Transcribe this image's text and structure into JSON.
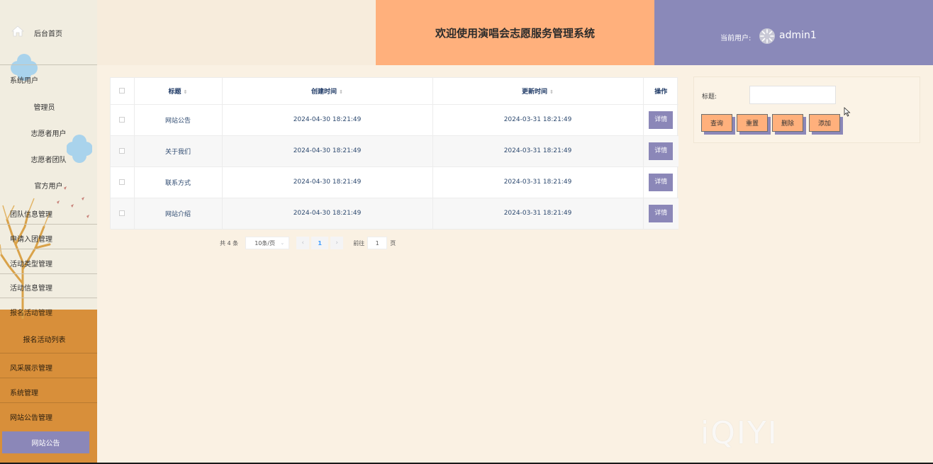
{
  "sidebar": {
    "home_label": "后台首页",
    "items": [
      {
        "label": "系统用户"
      },
      {
        "label": "管理员"
      },
      {
        "label": "志愿者用户"
      },
      {
        "label": "志愿者团队"
      },
      {
        "label": "官方用户"
      },
      {
        "label": "团队信息管理"
      },
      {
        "label": "申请入团管理"
      },
      {
        "label": "活动类型管理"
      },
      {
        "label": "活动信息管理"
      },
      {
        "label": "报名活动管理"
      },
      {
        "label": "报名活动列表"
      },
      {
        "label": "风采展示管理"
      },
      {
        "label": "系统管理"
      },
      {
        "label": "网站公告管理"
      },
      {
        "label": "网站公告"
      }
    ]
  },
  "header": {
    "title": "欢迎使用演唱会志愿服务管理系统",
    "current_user_label": "当前用户:",
    "username": "admin1"
  },
  "table": {
    "columns": [
      "标题",
      "创建时间",
      "更新时间",
      "操作"
    ],
    "rows": [
      {
        "title": "网站公告",
        "created": "2024-04-30 18:21:49",
        "updated": "2024-03-31 18:21:49",
        "action": "详情"
      },
      {
        "title": "关于我们",
        "created": "2024-04-30 18:21:49",
        "updated": "2024-03-31 18:21:49",
        "action": "详情"
      },
      {
        "title": "联系方式",
        "created": "2024-04-30 18:21:49",
        "updated": "2024-03-31 18:21:49",
        "action": "详情"
      },
      {
        "title": "网站介绍",
        "created": "2024-04-30 18:21:49",
        "updated": "2024-03-31 18:21:49",
        "action": "详情"
      }
    ]
  },
  "pager": {
    "total": "共 4 条",
    "page_size": "10条/页",
    "current_page": "1",
    "goto_label": "前往",
    "goto_value": "1",
    "page_unit": "页"
  },
  "search": {
    "title_label": "标题:",
    "title_value": "",
    "buttons": {
      "query": "查询",
      "reset": "重置",
      "delete": "删除",
      "add": "添加"
    }
  },
  "watermark": "iQIYI",
  "colors": {
    "primary_orange": "#ffb07c",
    "accent_purple": "#8b87b8",
    "background": "#faf1e3",
    "sidebar_orange": "#d88f3a"
  }
}
